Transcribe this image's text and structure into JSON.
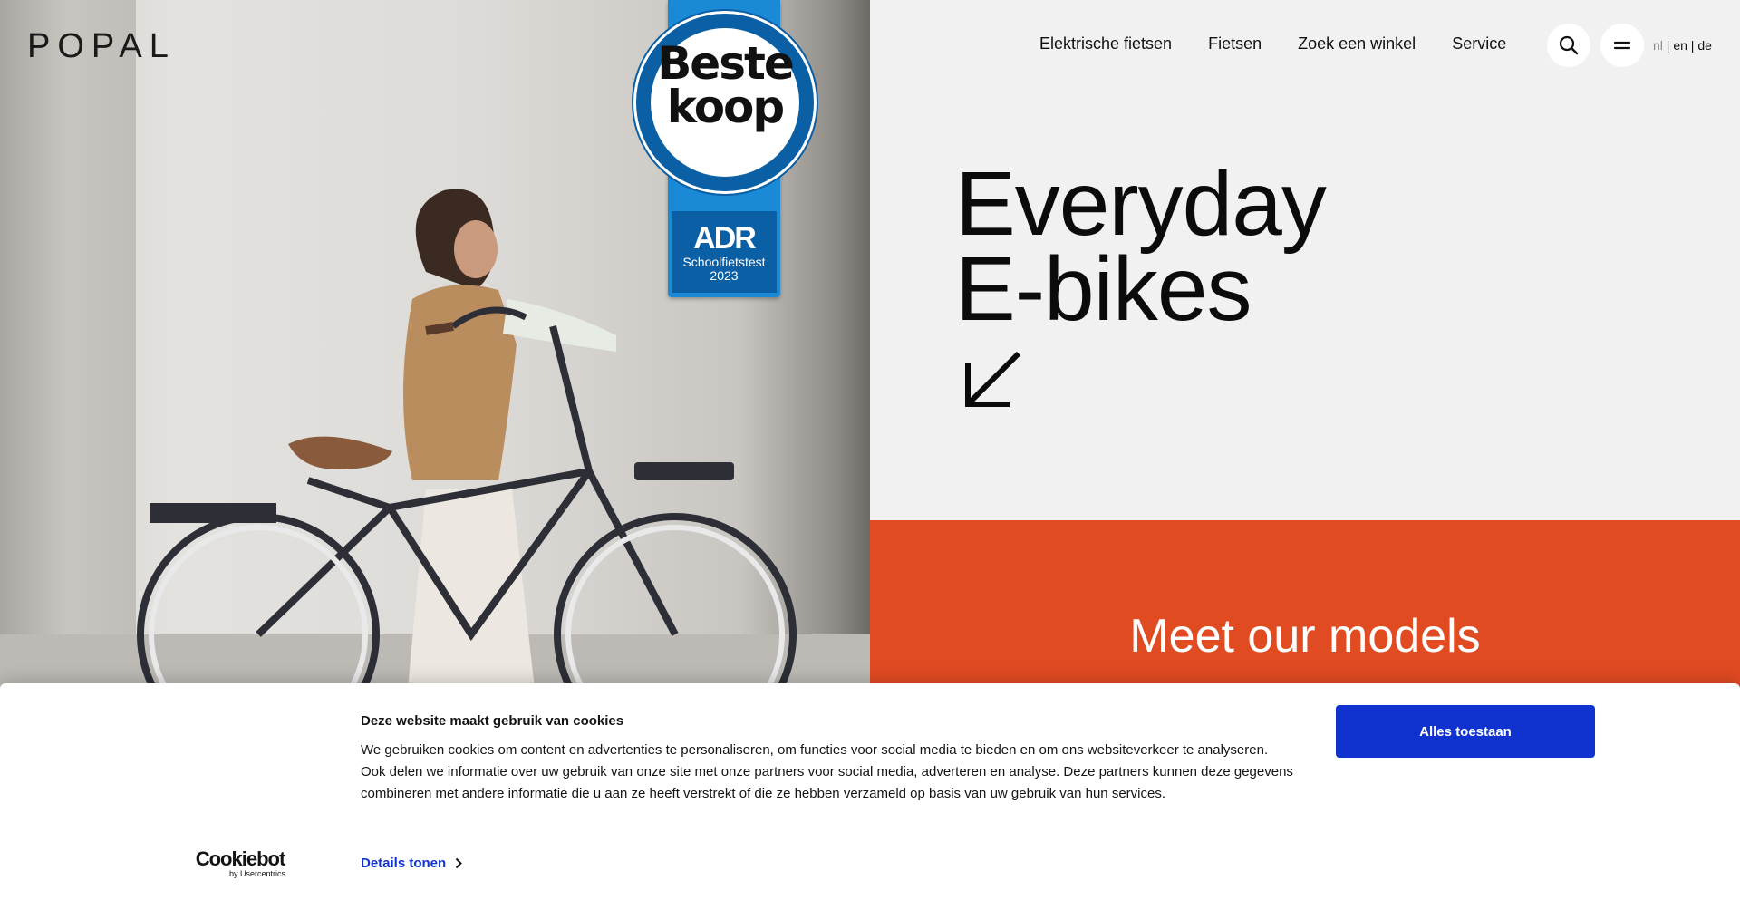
{
  "header": {
    "logo": "POPAL",
    "nav": [
      "Elektrische fietsen",
      "Fietsen",
      "Zoek een winkel",
      "Service"
    ],
    "search_icon": "search-icon",
    "menu_icon": "menu-icon",
    "lang": {
      "nl": "nl",
      "sep1": " | ",
      "en": "en",
      "sep2": " | ",
      "de": "de"
    }
  },
  "badge": {
    "line1": "Beste",
    "line2": "koop",
    "org": "ADR",
    "test_line1": "Schoolfietstest",
    "test_line2": "2023"
  },
  "hero": {
    "title_line1": "Everyday",
    "title_line2": "E-bikes",
    "arrow_icon": "arrow-down-left-icon"
  },
  "models": {
    "title": "Meet our models"
  },
  "cookie": {
    "title": "Deze website maakt gebruik van cookies",
    "text": "We gebruiken cookies om content en advertenties te personaliseren, om functies voor social media te bieden en om ons websiteverkeer te analyseren. Ook delen we informatie over uw gebruik van onze site met onze partners voor social media, adverteren en analyse. Deze partners kunnen deze gegevens combineren met andere informatie die u aan ze heeft verstrekt of die ze hebben verzameld op basis van uw gebruik van hun services.",
    "details_label": "Details tonen",
    "allow_label": "Alles toestaan",
    "brand": "Cookiebot",
    "brand_sub": "by Usercentrics",
    "accent": "#1032cf"
  },
  "colors": {
    "orange": "#e14b22",
    "badge_blue": "#0b5fa5",
    "ribbon_blue": "#1a8ad6"
  }
}
